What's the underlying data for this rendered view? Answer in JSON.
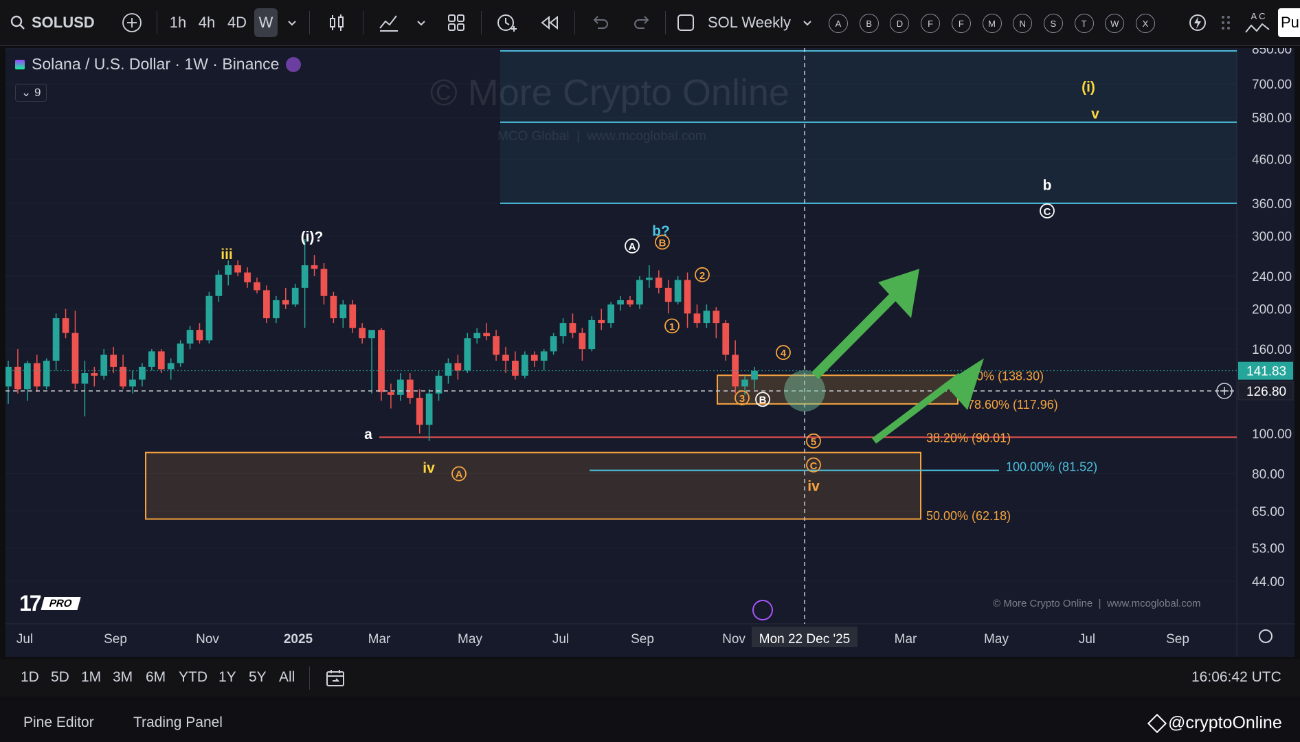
{
  "toolbar": {
    "symbol": "SOLUSD",
    "intervals": [
      "1h",
      "4h",
      "4D",
      "W"
    ],
    "layout_name": "SOL Weekly",
    "alphabet_buttons": [
      "A",
      "B",
      "D",
      "F",
      "F",
      "M",
      "N",
      "S",
      "T",
      "W",
      "X"
    ],
    "publish_partial": "Pu",
    "alpha_partial": "A C"
  },
  "legend": {
    "title": "Solana / U.S. Dollar · 1W · Binance",
    "indicator_count": "9"
  },
  "watermark": {
    "main": "© More Crypto Online",
    "sub": "MCO Global  |  www.mcoglobal.com",
    "corner": "© More Crypto Online  |  www.mcoglobal.com"
  },
  "chart_data": {
    "type": "candlestick",
    "symbol": "SOLUSD",
    "timeframe": "1W",
    "exchange": "Binance",
    "yscale": "log",
    "y_ticks": [
      850,
      700,
      580,
      460,
      360,
      300,
      240,
      200,
      160,
      100,
      80,
      65,
      53,
      44
    ],
    "y_tick_labels": [
      "850.00",
      "700.00",
      "580.00",
      "460.00",
      "360.00",
      "300.00",
      "240.00",
      "200.00",
      "160.00",
      "100.00",
      "80.00",
      "65.00",
      "53.00",
      "44.00"
    ],
    "x_labels": [
      "Jul",
      "Sep",
      "Nov",
      "2025",
      "Mar",
      "May",
      "Jul",
      "Sep",
      "Nov",
      "Mar",
      "May",
      "Jul",
      "Sep"
    ],
    "crosshair_date": "Mon 22 Dec '25",
    "last_price": "141.83",
    "crosshair_price": "126.80",
    "candles": [
      {
        "o": 130,
        "h": 150,
        "l": 118,
        "c": 145
      },
      {
        "o": 145,
        "h": 160,
        "l": 125,
        "c": 128
      },
      {
        "o": 128,
        "h": 150,
        "l": 120,
        "c": 148
      },
      {
        "o": 148,
        "h": 155,
        "l": 126,
        "c": 130
      },
      {
        "o": 130,
        "h": 152,
        "l": 128,
        "c": 150
      },
      {
        "o": 150,
        "h": 195,
        "l": 142,
        "c": 190
      },
      {
        "o": 190,
        "h": 200,
        "l": 170,
        "c": 175
      },
      {
        "o": 175,
        "h": 198,
        "l": 128,
        "c": 132
      },
      {
        "o": 132,
        "h": 150,
        "l": 110,
        "c": 140
      },
      {
        "o": 140,
        "h": 145,
        "l": 130,
        "c": 138
      },
      {
        "o": 138,
        "h": 160,
        "l": 135,
        "c": 155
      },
      {
        "o": 155,
        "h": 162,
        "l": 140,
        "c": 145
      },
      {
        "o": 145,
        "h": 155,
        "l": 128,
        "c": 130
      },
      {
        "o": 130,
        "h": 142,
        "l": 125,
        "c": 135
      },
      {
        "o": 135,
        "h": 148,
        "l": 130,
        "c": 145
      },
      {
        "o": 145,
        "h": 160,
        "l": 142,
        "c": 158
      },
      {
        "o": 158,
        "h": 160,
        "l": 140,
        "c": 143
      },
      {
        "o": 143,
        "h": 152,
        "l": 135,
        "c": 148
      },
      {
        "o": 148,
        "h": 168,
        "l": 145,
        "c": 165
      },
      {
        "o": 165,
        "h": 182,
        "l": 160,
        "c": 178
      },
      {
        "o": 178,
        "h": 185,
        "l": 165,
        "c": 168
      },
      {
        "o": 168,
        "h": 220,
        "l": 165,
        "c": 215
      },
      {
        "o": 215,
        "h": 248,
        "l": 208,
        "c": 242
      },
      {
        "o": 242,
        "h": 262,
        "l": 228,
        "c": 255
      },
      {
        "o": 255,
        "h": 262,
        "l": 240,
        "c": 245
      },
      {
        "o": 245,
        "h": 252,
        "l": 225,
        "c": 232
      },
      {
        "o": 232,
        "h": 238,
        "l": 218,
        "c": 222
      },
      {
        "o": 222,
        "h": 228,
        "l": 185,
        "c": 190
      },
      {
        "o": 190,
        "h": 215,
        "l": 185,
        "c": 210
      },
      {
        "o": 210,
        "h": 225,
        "l": 200,
        "c": 205
      },
      {
        "o": 205,
        "h": 230,
        "l": 202,
        "c": 225
      },
      {
        "o": 225,
        "h": 295,
        "l": 180,
        "c": 255
      },
      {
        "o": 255,
        "h": 270,
        "l": 240,
        "c": 250
      },
      {
        "o": 250,
        "h": 258,
        "l": 205,
        "c": 215
      },
      {
        "o": 215,
        "h": 220,
        "l": 185,
        "c": 190
      },
      {
        "o": 190,
        "h": 210,
        "l": 180,
        "c": 205
      },
      {
        "o": 205,
        "h": 210,
        "l": 175,
        "c": 180
      },
      {
        "o": 180,
        "h": 185,
        "l": 165,
        "c": 170
      },
      {
        "o": 170,
        "h": 178,
        "l": 125,
        "c": 178
      },
      {
        "o": 178,
        "h": 180,
        "l": 120,
        "c": 126
      },
      {
        "o": 126,
        "h": 132,
        "l": 115,
        "c": 124
      },
      {
        "o": 124,
        "h": 140,
        "l": 120,
        "c": 135
      },
      {
        "o": 135,
        "h": 140,
        "l": 118,
        "c": 122
      },
      {
        "o": 122,
        "h": 128,
        "l": 100,
        "c": 105
      },
      {
        "o": 105,
        "h": 128,
        "l": 96,
        "c": 125
      },
      {
        "o": 125,
        "h": 142,
        "l": 120,
        "c": 138
      },
      {
        "o": 138,
        "h": 152,
        "l": 132,
        "c": 148
      },
      {
        "o": 148,
        "h": 155,
        "l": 135,
        "c": 142
      },
      {
        "o": 142,
        "h": 175,
        "l": 140,
        "c": 170
      },
      {
        "o": 170,
        "h": 180,
        "l": 165,
        "c": 175
      },
      {
        "o": 175,
        "h": 185,
        "l": 168,
        "c": 172
      },
      {
        "o": 172,
        "h": 178,
        "l": 150,
        "c": 155
      },
      {
        "o": 155,
        "h": 162,
        "l": 140,
        "c": 150
      },
      {
        "o": 150,
        "h": 158,
        "l": 135,
        "c": 138
      },
      {
        "o": 138,
        "h": 158,
        "l": 136,
        "c": 155
      },
      {
        "o": 155,
        "h": 158,
        "l": 145,
        "c": 150
      },
      {
        "o": 150,
        "h": 160,
        "l": 142,
        "c": 158
      },
      {
        "o": 158,
        "h": 175,
        "l": 155,
        "c": 172
      },
      {
        "o": 172,
        "h": 190,
        "l": 165,
        "c": 185
      },
      {
        "o": 185,
        "h": 195,
        "l": 170,
        "c": 175
      },
      {
        "o": 175,
        "h": 180,
        "l": 150,
        "c": 160
      },
      {
        "o": 160,
        "h": 192,
        "l": 158,
        "c": 188
      },
      {
        "o": 188,
        "h": 200,
        "l": 178,
        "c": 185
      },
      {
        "o": 185,
        "h": 208,
        "l": 180,
        "c": 205
      },
      {
        "o": 205,
        "h": 215,
        "l": 198,
        "c": 210
      },
      {
        "o": 210,
        "h": 215,
        "l": 202,
        "c": 205
      },
      {
        "o": 205,
        "h": 240,
        "l": 200,
        "c": 235
      },
      {
        "o": 235,
        "h": 255,
        "l": 225,
        "c": 238
      },
      {
        "o": 238,
        "h": 248,
        "l": 218,
        "c": 225
      },
      {
        "o": 225,
        "h": 235,
        "l": 195,
        "c": 208
      },
      {
        "o": 208,
        "h": 240,
        "l": 205,
        "c": 235
      },
      {
        "o": 235,
        "h": 245,
        "l": 180,
        "c": 195
      },
      {
        "o": 195,
        "h": 205,
        "l": 180,
        "c": 185
      },
      {
        "o": 185,
        "h": 205,
        "l": 180,
        "c": 198
      },
      {
        "o": 198,
        "h": 202,
        "l": 170,
        "c": 185
      },
      {
        "o": 185,
        "h": 188,
        "l": 150,
        "c": 155
      },
      {
        "o": 155,
        "h": 168,
        "l": 125,
        "c": 130
      },
      {
        "o": 130,
        "h": 138,
        "l": 124,
        "c": 135
      },
      {
        "o": 135,
        "h": 145,
        "l": 128,
        "c": 141.83
      }
    ],
    "fib_levels": [
      {
        "label": "78.60% (117.96)",
        "value": 117.96,
        "color": "#f7a440"
      },
      {
        "label": "38.20% (90.01)",
        "value": 90.01,
        "color": "#f7a440"
      },
      {
        "label": "100.00% (81.52)",
        "value": 81.52,
        "color": "#4dc3e0"
      },
      {
        "label": "50.00% (62.18)",
        "value": 62.18,
        "color": "#f7a440"
      },
      {
        "label": ".80% (138.30)",
        "value": 138.3,
        "color": "#f7a440"
      }
    ],
    "wave_labels": [
      "iii",
      "(i)?",
      "a",
      "iv",
      "A",
      "A",
      "B",
      "b?",
      "1",
      "2",
      "3",
      "4",
      "5",
      "C",
      "B",
      "iv",
      "b",
      "C",
      "(i)",
      "v"
    ]
  },
  "time_bar": {
    "ranges": [
      "1D",
      "5D",
      "1M",
      "3M",
      "6M",
      "YTD",
      "1Y",
      "5Y",
      "All"
    ],
    "clock": "16:06:42 UTC"
  },
  "footer": {
    "tabs": [
      "Pine Editor",
      "Trading Panel"
    ],
    "handle": "@cryptoOnline"
  },
  "colors": {
    "up": "#26a69a",
    "down": "#ef5350",
    "fib": "#f7a440",
    "cyan": "#4dc3e0",
    "arrow": "#4caf50",
    "wave_yellow": "#ffd740"
  },
  "icons": [
    "search-icon",
    "plus-circle-icon",
    "candles-icon",
    "indicators-icon",
    "layout-icon",
    "alert-icon",
    "replay-icon",
    "undo-icon",
    "redo-icon",
    "settings-icon",
    "calendar-icon"
  ]
}
